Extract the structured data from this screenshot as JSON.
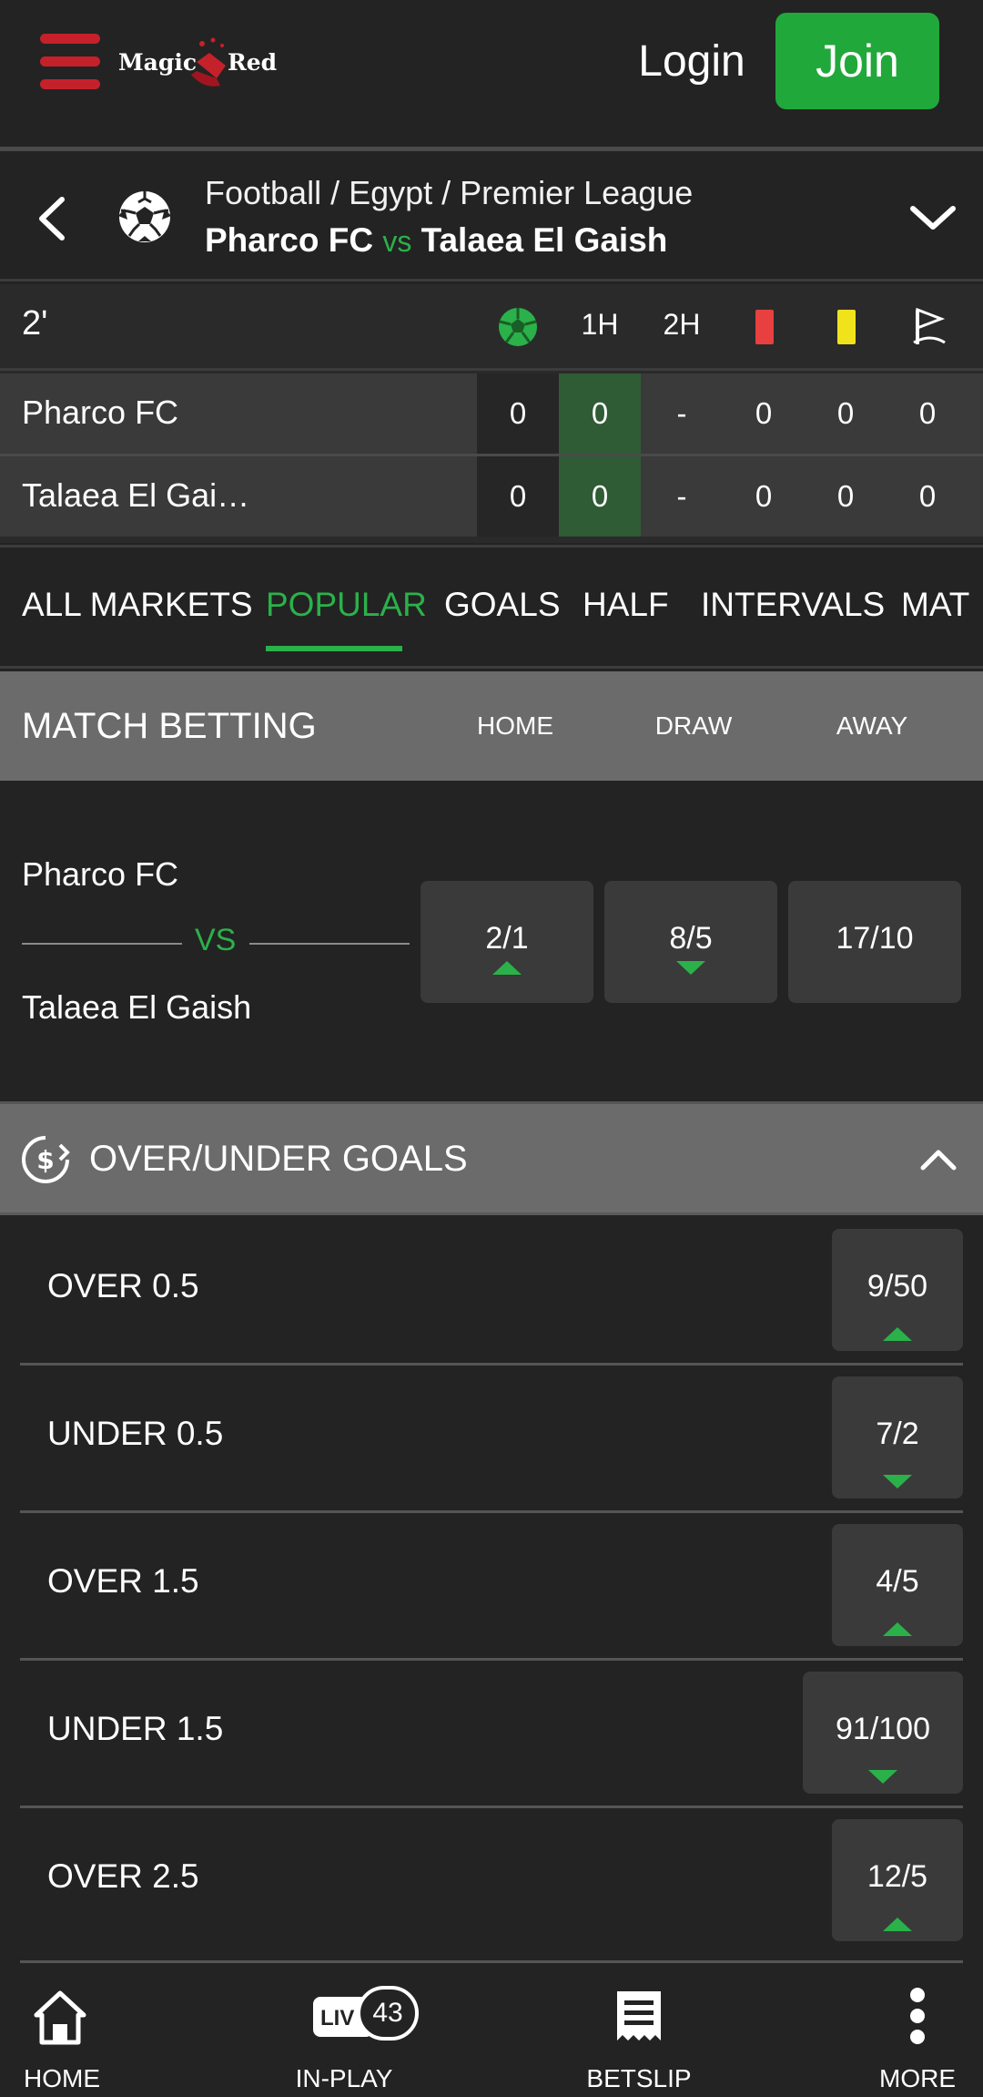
{
  "header": {
    "logo_text_1": "Magic",
    "logo_text_2": "Red",
    "login_label": "Login",
    "join_label": "Join"
  },
  "match": {
    "breadcrumb": "Football / Egypt / Premier League",
    "home_team": "Pharco FC",
    "vs": "vs",
    "away_team": "Talaea El Gaish"
  },
  "scoreboard": {
    "minute": "2'",
    "columns": [
      "1H",
      "2H"
    ],
    "rows": [
      {
        "team": "Pharco FC",
        "total": "0",
        "h1": "0",
        "h2": "-",
        "red": "0",
        "yellow": "0",
        "corners": "0"
      },
      {
        "team": "Talaea El Gai…",
        "total": "0",
        "h1": "0",
        "h2": "-",
        "red": "0",
        "yellow": "0",
        "corners": "0"
      }
    ]
  },
  "tabs": [
    "ALL MARKETS",
    "POPULAR",
    "GOALS",
    "HALF",
    "INTERVALS",
    "MAT"
  ],
  "active_tab": "POPULAR",
  "match_betting": {
    "title": "MATCH BETTING",
    "columns": [
      "HOME",
      "DRAW",
      "AWAY"
    ],
    "home_team": "Pharco FC",
    "vs": "VS",
    "away_team": "Talaea El Gaish",
    "odds": [
      {
        "value": "2/1",
        "trend": "up"
      },
      {
        "value": "8/5",
        "trend": "down"
      },
      {
        "value": "17/10",
        "trend": "none"
      }
    ]
  },
  "over_under": {
    "title": "OVER/UNDER GOALS",
    "rows": [
      {
        "label": "OVER 0.5",
        "odds": "9/50",
        "trend": "up"
      },
      {
        "label": "UNDER 0.5",
        "odds": "7/2",
        "trend": "down"
      },
      {
        "label": "OVER 1.5",
        "odds": "4/5",
        "trend": "up"
      },
      {
        "label": "UNDER 1.5",
        "odds": "91/100",
        "trend": "down"
      },
      {
        "label": "OVER 2.5",
        "odds": "12/5",
        "trend": "up"
      }
    ]
  },
  "bottom_nav": {
    "home": "HOME",
    "inplay": "IN-PLAY",
    "live_badge": "LIV",
    "live_count": "43",
    "betslip": "BETSLIP",
    "more": "MORE"
  },
  "colors": {
    "accent_green": "#2bb14a",
    "join_green": "#21a83a",
    "brand_red": "#c5212b",
    "red_card": "#e84040",
    "yellow_card": "#f0e21b",
    "background": "#232323"
  },
  "icons": [
    "menu-icon",
    "back-arrow-icon",
    "soccer-ball-icon",
    "chevron-down-icon",
    "red-card-icon",
    "yellow-card-icon",
    "corner-flag-icon",
    "dollar-icon",
    "chevron-up-icon",
    "home-icon",
    "live-icon",
    "betslip-icon",
    "more-icon"
  ]
}
